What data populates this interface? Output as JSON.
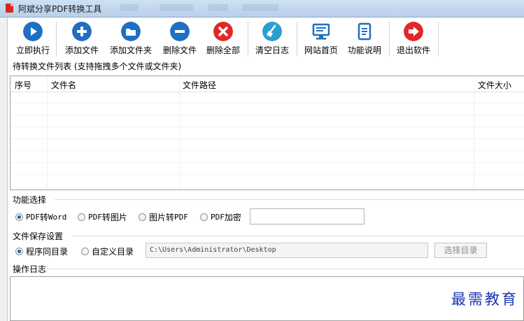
{
  "window": {
    "title": "阿斌分享PDF转换工具"
  },
  "toolbar": {
    "buttons": [
      {
        "label": "立即执行",
        "icon": "play-icon",
        "color": "#1f6fc2"
      },
      {
        "label": "添加文件",
        "icon": "plus-icon",
        "color": "#1f6fc2"
      },
      {
        "label": "添加文件夹",
        "icon": "folder-icon",
        "color": "#1f6fc2"
      },
      {
        "label": "删除文件",
        "icon": "minus-icon",
        "color": "#1f6fc2"
      },
      {
        "label": "删除全部",
        "icon": "close-icon",
        "color": "#e02828"
      },
      {
        "label": "清空日志",
        "icon": "broom-icon",
        "color": "#2a9fd0"
      },
      {
        "label": "网站首页",
        "icon": "monitor-icon",
        "color": "#1f6fc2"
      },
      {
        "label": "功能说明",
        "icon": "document-icon",
        "color": "#1f6fc2"
      },
      {
        "label": "退出软件",
        "icon": "exit-icon",
        "color": "#e02828"
      }
    ]
  },
  "file_list": {
    "title": "待转换文件列表 (支持拖拽多个文件或文件夹)",
    "columns": [
      "序号",
      "文件名",
      "文件路径",
      "文件大小"
    ],
    "rows": []
  },
  "function": {
    "title": "功能选择",
    "options": [
      {
        "label_latin": "PDF",
        "label_cjk": "转",
        "label_tail": "Word",
        "selected": true
      },
      {
        "label_latin": "PDF",
        "label_cjk": "转图片",
        "label_tail": "",
        "selected": false
      },
      {
        "label_latin": "",
        "label_cjk": "图片转",
        "label_tail": "PDF",
        "selected": false
      },
      {
        "label_latin": "PDF",
        "label_cjk": "加密",
        "label_tail": "",
        "selected": false
      }
    ],
    "password_value": ""
  },
  "save": {
    "title": "文件保存设置",
    "options": [
      {
        "label": "程序同目录",
        "selected": true
      },
      {
        "label": "自定义目录",
        "selected": false
      }
    ],
    "path_value": "C:\\Users\\Administrator\\Desktop",
    "select_button": "选择目录"
  },
  "log": {
    "title": "操作日志",
    "content": ""
  },
  "watermark": "最需教育"
}
